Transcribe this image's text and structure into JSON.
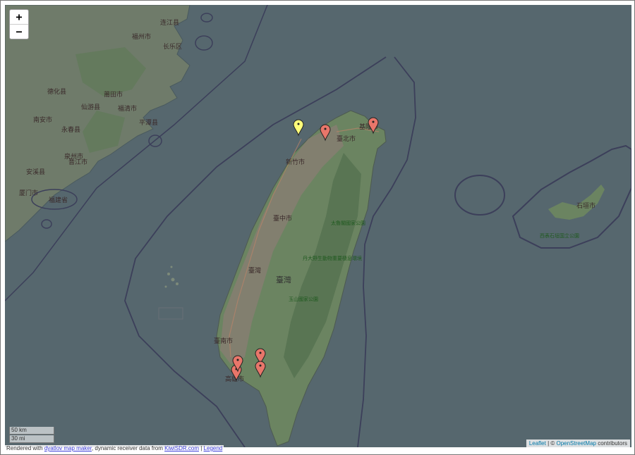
{
  "zoom": {
    "in_label": "+",
    "out_label": "−"
  },
  "scale": {
    "km": "50 km",
    "mi": "30 mi"
  },
  "attribution": {
    "leaflet": "Leaflet",
    "sep": " | © ",
    "osm": "OpenStreetMap",
    "suffix": " contributors"
  },
  "footer": {
    "prefix": "Rendered with ",
    "tool_link": "dyatlov map maker",
    "middle": ", dynamic receiver data from ",
    "data_link": "KiwiSDR.com",
    "sep": " | ",
    "legend_link": "Legend"
  },
  "map_labels": {
    "fuzhou": "福州市",
    "putian": "莆田市",
    "quanzhou": "泉州市",
    "xiamen": "厦门市",
    "fujian": "福建省",
    "taipei": "臺北市",
    "keelung": "基隆市",
    "hsinchu": "新竹市",
    "taichung": "臺中市",
    "taiwan_region": "臺灣",
    "taiwan": "臺灣",
    "tainan": "臺南市",
    "kaohsiung": "高雄市",
    "ishigaki": "石垣市",
    "nanan": "南安市",
    "jinjiang": "晋江市",
    "pingtan": "平潭县",
    "changle": "长乐区",
    "dehua": "德化县",
    "anxi": "安溪县",
    "yongchun": "永春县",
    "xianyou": "仙游县",
    "lianjiang": "连江县",
    "fuqing": "福清市"
  },
  "park_labels": {
    "taroko": "太魯閣國家公園",
    "yushan": "玉山國家公園",
    "wildlife": "丹大野生動物重要棲息環境",
    "iriomote": "西表石垣国立公園"
  },
  "markers": [
    {
      "name": "marker-north-coast",
      "color": "#e8766a"
    },
    {
      "name": "marker-yellow-offshore",
      "color": "#ffff7a"
    },
    {
      "name": "marker-northeast-coast",
      "color": "#e8766a"
    },
    {
      "name": "marker-kaohsiung-1",
      "color": "#e8766a"
    },
    {
      "name": "marker-kaohsiung-2",
      "color": "#e8766a"
    },
    {
      "name": "marker-pingtung-1",
      "color": "#e8766a"
    },
    {
      "name": "marker-pingtung-2",
      "color": "#e8766a"
    }
  ]
}
